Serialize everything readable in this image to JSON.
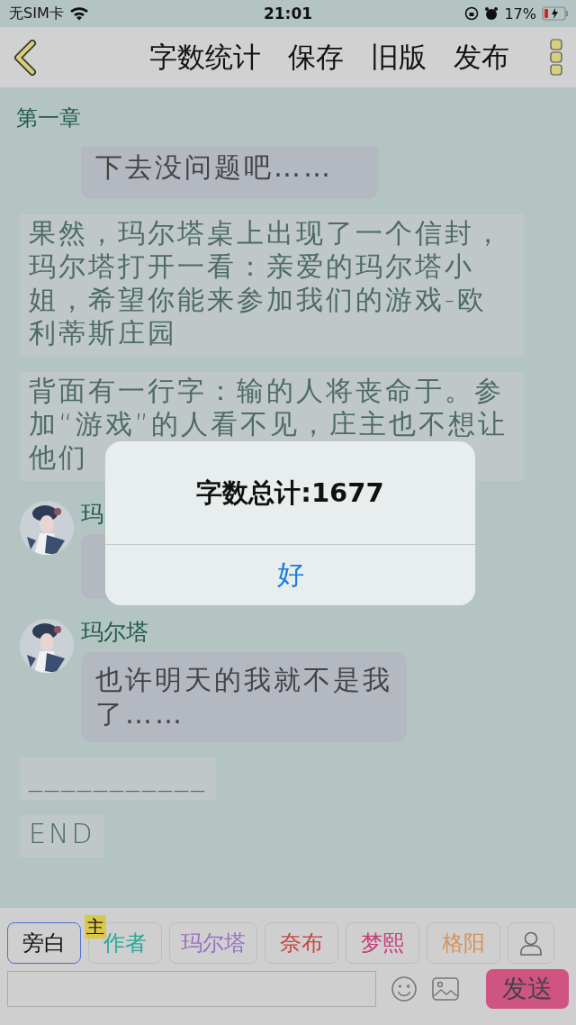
{
  "status_bar": {
    "carrier": "无SIM卡",
    "time": "21:01",
    "battery": "17%"
  },
  "toolbar": {
    "actions": [
      "字数统计",
      "保存",
      "旧版",
      "发布"
    ]
  },
  "chapter": {
    "title": "第一章"
  },
  "entries": [
    {
      "kind": "bubble",
      "text": "下去没问题吧……"
    },
    {
      "kind": "narration",
      "text": "果然，玛尔塔桌上出现了一个信封，玛尔塔打开一看：亲爱的玛尔塔小姐，希望你能来参加我们的游戏-欧利蒂斯庄园"
    },
    {
      "kind": "narration",
      "text": "背面有一行字：输的人将丧命于。参加“游戏”的人看不见，庄主也不想让他们"
    },
    {
      "kind": "message",
      "name": "玛"
    },
    {
      "kind": "message",
      "name": "玛尔塔",
      "text": "也许明天的我就不是我了……"
    },
    {
      "kind": "narration",
      "text": "___________"
    },
    {
      "kind": "narration",
      "text": "END"
    }
  ],
  "roles": [
    {
      "label": "旁白",
      "color": "#111111",
      "selected": true
    },
    {
      "label": "作者",
      "color": "#2aa79a",
      "selected": false,
      "badge": "主"
    },
    {
      "label": "玛尔塔",
      "color": "#9a6fc0",
      "selected": false
    },
    {
      "label": "奈布",
      "color": "#c9443a",
      "selected": false
    },
    {
      "label": "梦熙",
      "color": "#c93a78",
      "selected": false
    },
    {
      "label": "格阳",
      "color": "#d5925a",
      "selected": false
    }
  ],
  "composer": {
    "send": "发送"
  },
  "alert": {
    "message": "字数总计:1677",
    "button": "好"
  }
}
